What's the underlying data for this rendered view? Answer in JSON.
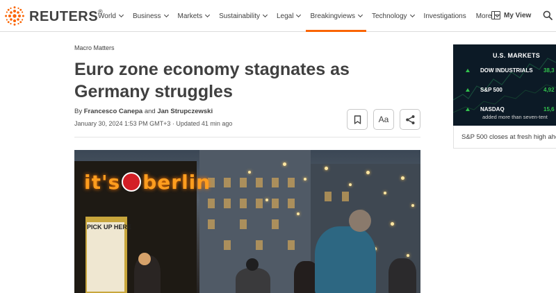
{
  "brand": {
    "name": "REUTERS",
    "mark": "®"
  },
  "nav": {
    "items": [
      {
        "label": "World",
        "dropdown": true
      },
      {
        "label": "Business",
        "dropdown": true
      },
      {
        "label": "Markets",
        "dropdown": true
      },
      {
        "label": "Sustainability",
        "dropdown": true
      },
      {
        "label": "Legal",
        "dropdown": true
      },
      {
        "label": "Breakingviews",
        "dropdown": true,
        "active": true
      },
      {
        "label": "Technology",
        "dropdown": true
      },
      {
        "label": "Investigations",
        "dropdown": false
      },
      {
        "label": "More",
        "dropdown": true
      }
    ],
    "my_view": "My View",
    "accent": "#fa6400"
  },
  "article": {
    "section": "Macro Matters",
    "headline_line1": "Euro zone economy stagnates as",
    "headline_line2": "Germany struggles",
    "by": "By",
    "author1": "Francesco Canepa",
    "and": "and",
    "author2": "Jan Strupczewski",
    "dateline": "January 30, 2024 1:53 PM GMT+3 · Updated 41 min ago",
    "font_size_button": "Aa",
    "image": {
      "sign_left": "it's",
      "sign_right": "berlin",
      "kiosk_label": "PICK UP HERE"
    }
  },
  "markets": {
    "title": "U.S. MARKETS",
    "rows": [
      {
        "name": "DOW INDUSTRIALS",
        "value": "38,3",
        "direction": "up"
      },
      {
        "name": "S&P 500",
        "value": "4,92",
        "direction": "up"
      },
      {
        "name": "NASDAQ",
        "value": "15,6",
        "direction": "up"
      }
    ],
    "ticker_note": "added more than seven-tent",
    "headline": "S&P 500 closes at fresh high ahe",
    "up_color": "#32c24d"
  }
}
